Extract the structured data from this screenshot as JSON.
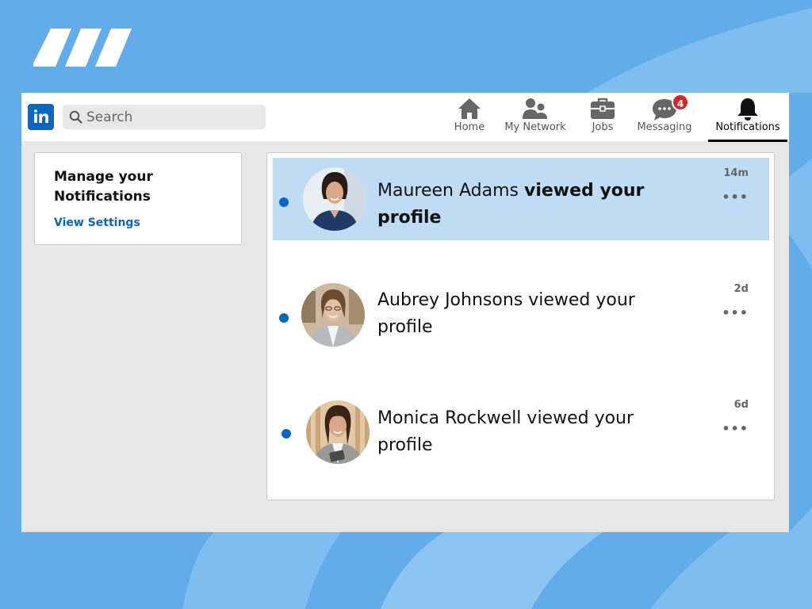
{
  "colors": {
    "background": "#62acea",
    "linkedin_blue": "#0a66c2",
    "unread_highlight": "#bedcf3",
    "badge_red": "#d0282e"
  },
  "logo": {
    "text": "in",
    "icon": "linkedin-logo"
  },
  "search": {
    "placeholder": "Search",
    "icon": "search-icon"
  },
  "nav": [
    {
      "label": "Home",
      "icon": "home-icon"
    },
    {
      "label": "My Network",
      "icon": "people-icon"
    },
    {
      "label": "Jobs",
      "icon": "briefcase-icon"
    },
    {
      "label": "Messaging",
      "icon": "chat-bubble-icon",
      "badge": "4"
    },
    {
      "label": "Notifications",
      "icon": "bell-icon",
      "active": true
    }
  ],
  "sidebar": {
    "title": "Manage your Notifications",
    "link": "View Settings"
  },
  "notifications": [
    {
      "name": "Maureen Adams",
      "action": "viewed your profile",
      "time": "14m",
      "unread_highlight": true,
      "more": "•••"
    },
    {
      "name": "Aubrey Johnsons",
      "action": "viewed your profile",
      "time": "2d",
      "unread_highlight": false,
      "more": "•••"
    },
    {
      "name": "Monica Rockwell",
      "action": "viewed your profile",
      "time": "6d",
      "unread_highlight": false,
      "more": "•••"
    }
  ]
}
